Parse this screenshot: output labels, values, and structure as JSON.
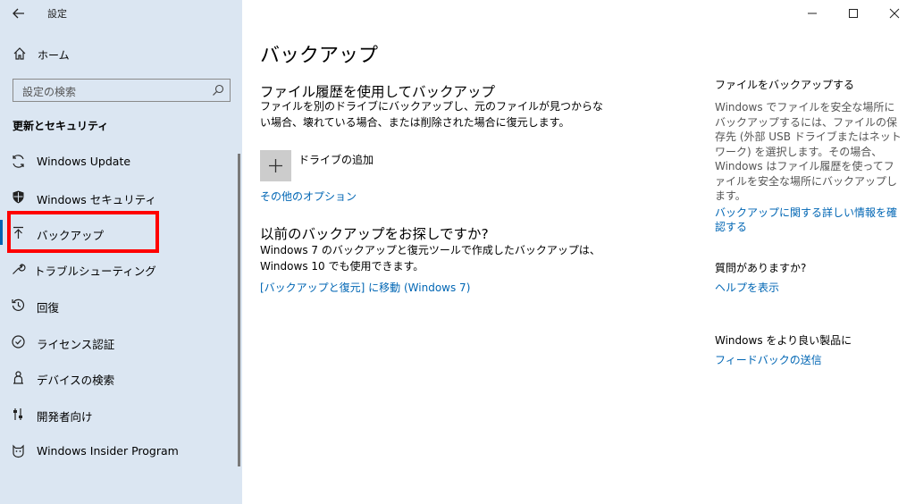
{
  "window": {
    "title": "設定",
    "back_icon": "arrow-left-icon",
    "controls": {
      "minimize": "—",
      "maximize": "☐",
      "close": "✕"
    }
  },
  "sidebar": {
    "home_label": "ホーム",
    "search_placeholder": "設定の検索",
    "section_heading": "更新とセキュリティ",
    "items": [
      {
        "label": "Windows Update",
        "icon": "sync-icon"
      },
      {
        "label": "Windows セキュリティ",
        "icon": "shield-icon"
      },
      {
        "label": "バックアップ",
        "icon": "backup-arrow-icon",
        "selected": true
      },
      {
        "label": "トラブルシューティング",
        "icon": "wrench-icon"
      },
      {
        "label": "回復",
        "icon": "recovery-icon"
      },
      {
        "label": "ライセンス認証",
        "icon": "checkmark-circle-icon"
      },
      {
        "label": "デバイスの検索",
        "icon": "person-location-icon"
      },
      {
        "label": "開発者向け",
        "icon": "developer-sliders-icon"
      },
      {
        "label": "Windows Insider Program",
        "icon": "insider-cat-icon"
      }
    ]
  },
  "main": {
    "title": "バックアップ",
    "file_history": {
      "heading": "ファイル履歴を使用してバックアップ",
      "description": "ファイルを別のドライブにバックアップし、元のファイルが見つからない場合、壊れている場合、または削除された場合に復元します。",
      "add_drive_label": "ドライブの追加",
      "more_options": "その他のオプション"
    },
    "older_backup": {
      "heading": "以前のバックアップをお探しですか?",
      "description": "Windows 7 のバックアップと復元ツールで作成したバックアップは、Windows 10 でも使用できます。",
      "link": "[バックアップと復元] に移動 (Windows 7)"
    }
  },
  "right_column": {
    "backup_heading": "ファイルをバックアップする",
    "backup_text": "Windows でファイルを安全な場所にバックアップするには、ファイルの保存先 (外部 USB ドライブまたはネットワーク) を選択します。その場合、Windows はファイル履歴を使ってファイルを安全な場所にバックアップします。",
    "backup_link": "バックアップに関する詳しい情報を確認する",
    "question_heading": "質問がありますか?",
    "help_link": "ヘルプを表示",
    "improve_heading": "Windows をより良い製品に",
    "feedback_link": "フィードバックの送信"
  },
  "colors": {
    "sidebar_bg": "#dbe6f2",
    "link": "#0066b4",
    "accent": "#0063b1",
    "highlight": "#ff0000"
  }
}
